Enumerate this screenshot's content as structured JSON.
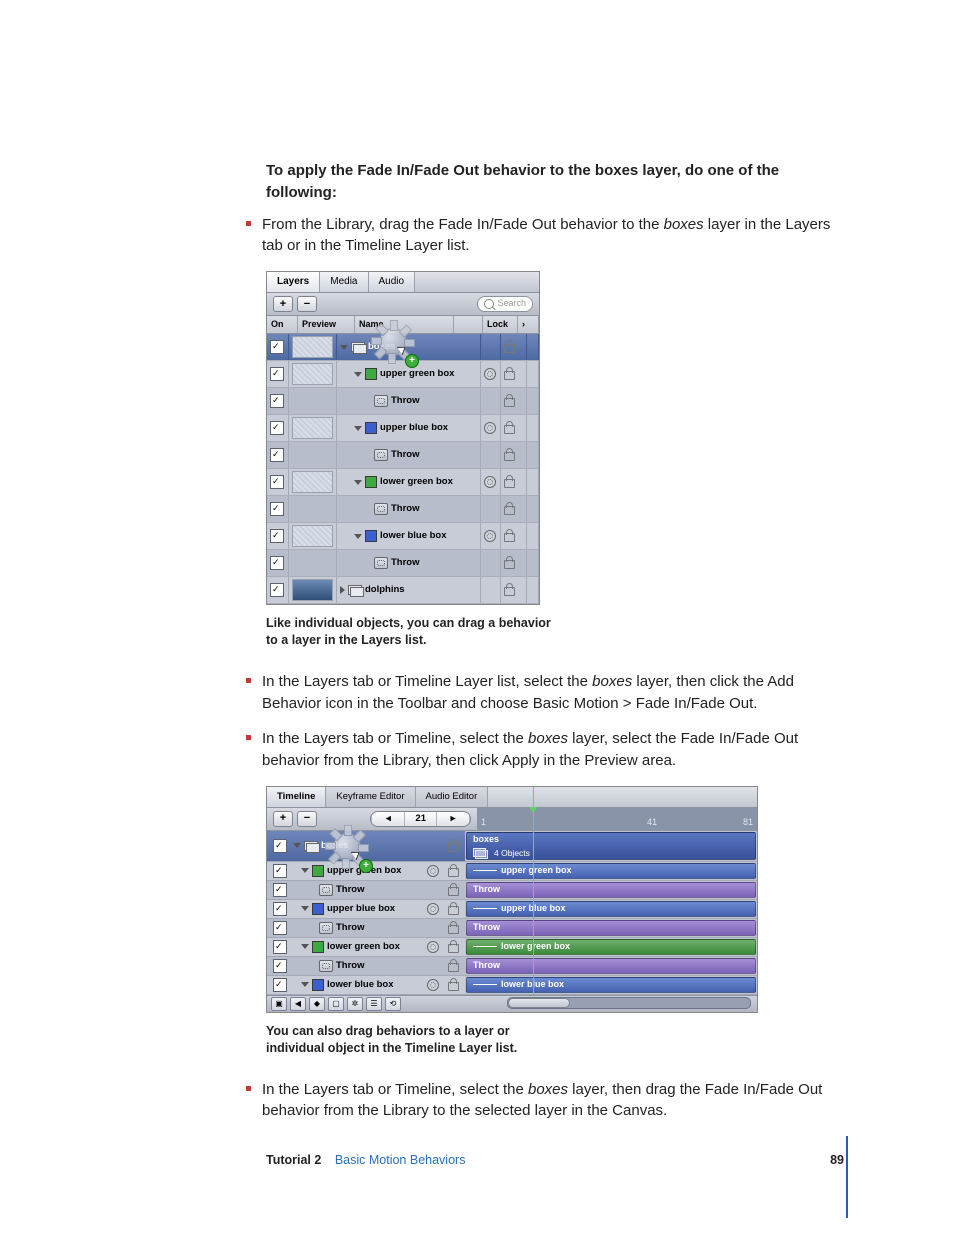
{
  "heading": "To apply the Fade In/Fade Out behavior to the boxes layer, do one of the following:",
  "bullets": {
    "b1a": "From the Library, drag the Fade In/Fade Out behavior to the ",
    "b1i": "boxes",
    "b1b": " layer in the Layers tab or in the Timeline Layer list.",
    "b2a": "In the Layers tab or Timeline Layer list, select the ",
    "b2i": "boxes",
    "b2b": " layer, then click the Add Behavior icon in the Toolbar and choose Basic Motion > Fade In/Fade Out.",
    "b3a": "In the Layers tab or Timeline, select the ",
    "b3i": "boxes",
    "b3b": " layer, select the Fade In/Fade Out behavior from the Library, then click Apply in the Preview area.",
    "b4a": "In the Layers tab or Timeline, select the ",
    "b4i": "boxes",
    "b4b": " layer, then drag the Fade In/Fade Out behavior from the Library to the selected layer in the Canvas."
  },
  "caption1": "Like individual objects, you can drag a behavior to a layer in the Layers list.",
  "caption2": "You can also drag behaviors to a layer or individual object in the Timeline Layer list.",
  "footer": {
    "tutorial": "Tutorial 2",
    "chapter": "Basic Motion Behaviors",
    "page": "89"
  },
  "ss1": {
    "tabs": {
      "layers": "Layers",
      "media": "Media",
      "audio": "Audio"
    },
    "plus": "+",
    "minus": "−",
    "search": "Search",
    "cols": {
      "on": "On",
      "preview": "Preview",
      "name": "Name",
      "lock": "Lock"
    },
    "rows": {
      "boxes": "boxes",
      "ugb": "upper green box",
      "t1": "Throw",
      "ubb": "upper blue box",
      "t2": "Throw",
      "lgb": "lower green box",
      "t3": "Throw",
      "lbb": "lower blue box",
      "t4": "Throw",
      "dolphins": "dolphins"
    }
  },
  "ss2": {
    "tabs": {
      "timeline": "Timeline",
      "kf": "Keyframe Editor",
      "audio": "Audio Editor"
    },
    "plus": "+",
    "minus": "−",
    "frame": "21",
    "ruler": {
      "a": "1",
      "b": "41",
      "c": "81"
    },
    "rows": {
      "boxes": "boxes",
      "boxes_sub": "4 Objects",
      "ugb": "upper green box",
      "t1": "Throw",
      "ubb": "upper blue box",
      "t2": "Throw",
      "lgb": "lower green box",
      "t3": "Throw",
      "lbb": "lower blue box"
    },
    "bars": {
      "boxes": "boxes",
      "ugb": "upper green box",
      "t1": "Throw",
      "ubb": "upper blue box",
      "t2": "Throw",
      "lgb": "lower green box",
      "t3": "Throw",
      "lbb": "lower blue box"
    }
  }
}
